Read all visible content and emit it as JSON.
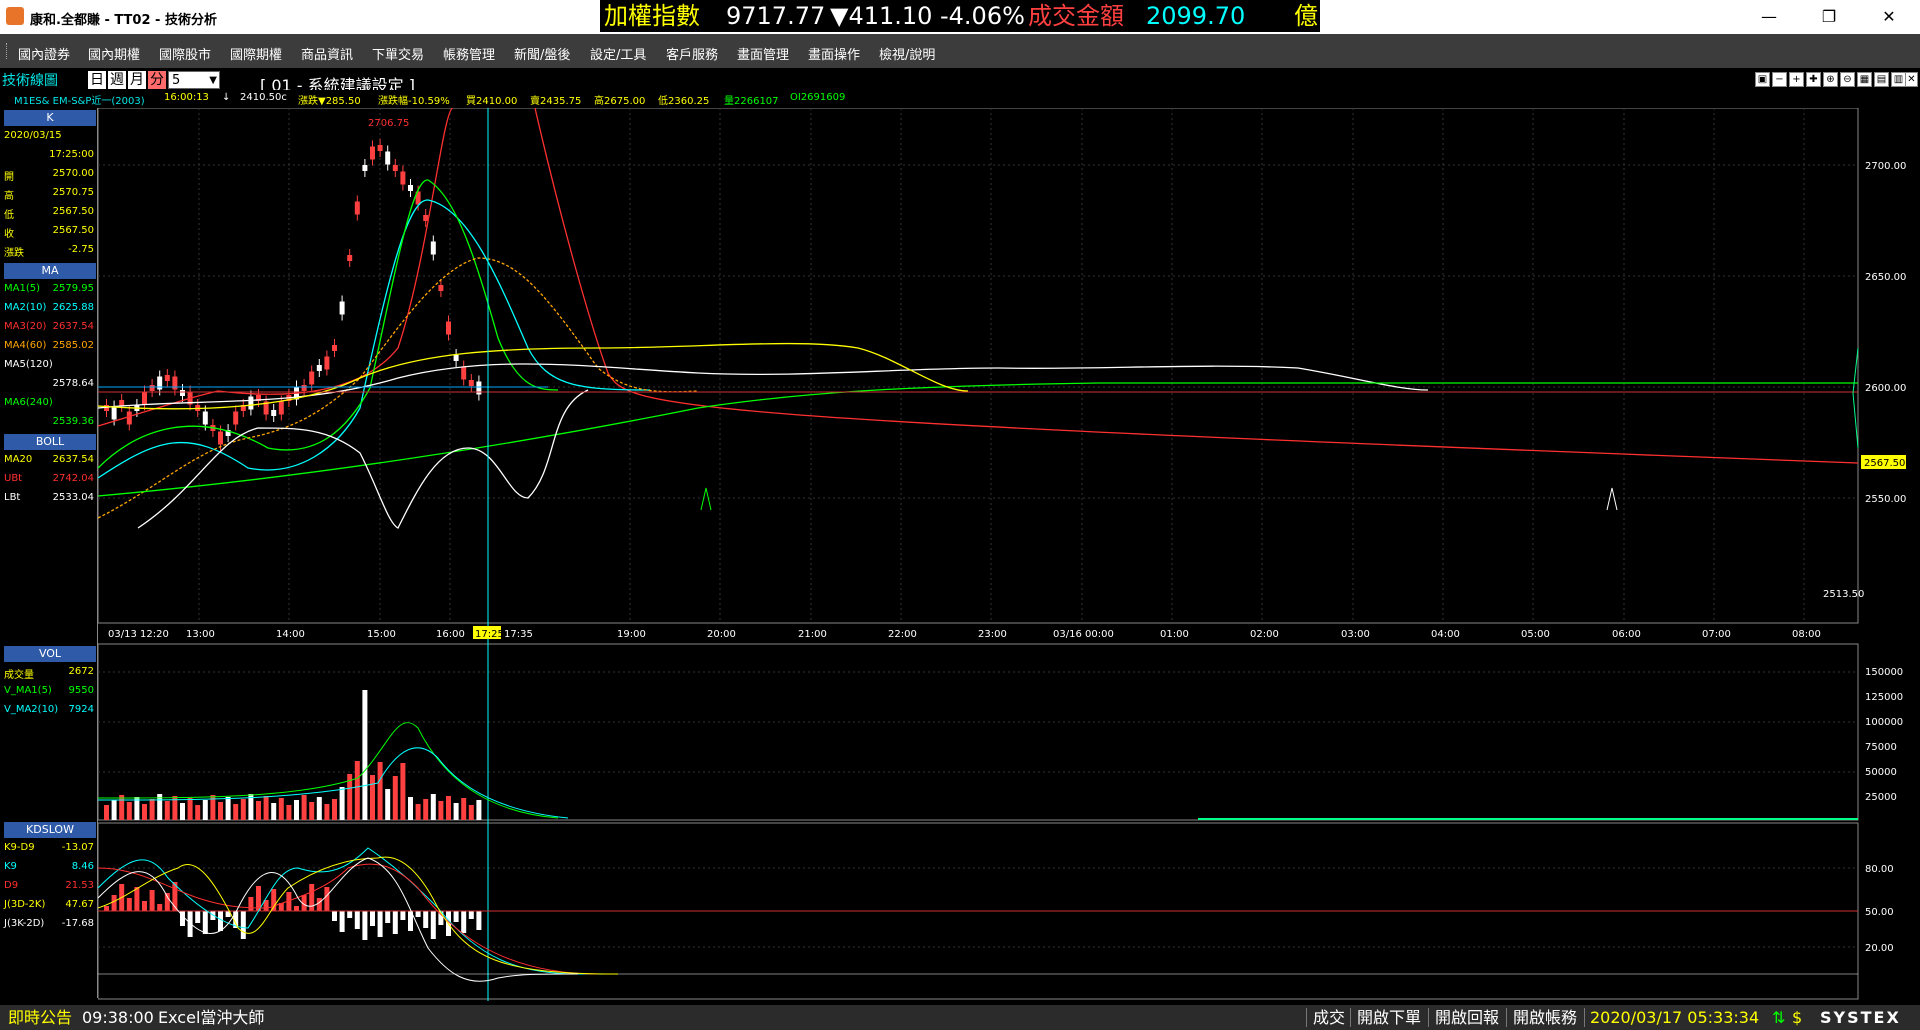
{
  "app": {
    "title": "康和.全都賺 - TT02 - 技術分析"
  },
  "ticker": {
    "label": "加權指數",
    "value": "9717.77",
    "change": "▼411.10",
    "pct": "-4.06%",
    "vol_label": "成交金額",
    "vol_value": "2099.70",
    "unit": "億",
    "colors": {
      "label": "#ffff00",
      "value": "#ffffff",
      "down": "#ffffff",
      "vol_label": "#ff4040",
      "vol_value": "#00ffff",
      "unit": "#ffff00"
    }
  },
  "window_controls": {
    "minimize": "—",
    "maximize": "❐",
    "close": "✕"
  },
  "menu": [
    "國內證券",
    "國內期權",
    "國際股市",
    "國際期權",
    "商品資訊",
    "下單交易",
    "帳務管理",
    "新聞/盤後",
    "設定/工具",
    "客戶服務",
    "畫面管理",
    "畫面操作",
    "檢視/說明"
  ],
  "toolbar": {
    "title": "技術線圖",
    "periods": [
      "日",
      "週",
      "月",
      "分"
    ],
    "active_period": "分",
    "interval": "5",
    "config": "[ 01 - 系統建議設定 ]",
    "icons": [
      "restore-icon",
      "minus-icon",
      "plus-icon",
      "cross-icon",
      "zoom-in-icon",
      "zoom-out-icon",
      "image-icon",
      "save-icon",
      "print-icon",
      "settings-icon"
    ]
  },
  "quote": {
    "symbol": "M1ES& EM-S&P近一(2003)",
    "time": "16:00:13",
    "arrow": "↓",
    "last": "2410.50c",
    "chg": "漲跌▼285.50",
    "chgpct": "漲跌幅-10.59%",
    "bid": "買2410.00",
    "ask": "賣2435.75",
    "high": "高2675.00",
    "low": "低2360.25",
    "vol": "量2266107",
    "oi": "OI2691609"
  },
  "left": {
    "k": {
      "head": "K",
      "date": "2020/03/15",
      "time": "17:25:00",
      "rows": [
        {
          "label": "開",
          "value": "2570.00"
        },
        {
          "label": "高",
          "value": "2570.75"
        },
        {
          "label": "低",
          "value": "2567.50"
        },
        {
          "label": "收",
          "value": "2567.50"
        },
        {
          "label": "漲跌",
          "value": "-2.75"
        }
      ]
    },
    "ma": {
      "head": "MA",
      "rows": [
        {
          "label": "MA1(5)",
          "value": "2579.95",
          "color": "#00ff00"
        },
        {
          "label": "MA2(10)",
          "value": "2625.88",
          "color": "#00ffff"
        },
        {
          "label": "MA3(20)",
          "value": "2637.54",
          "color": "#ff3030"
        },
        {
          "label": "MA4(60)",
          "value": "2585.02",
          "color": "#ffa500"
        },
        {
          "label": "MA5(120)",
          "value": "2578.64",
          "color": "#ffffff"
        },
        {
          "label": "MA6(240)",
          "value": "2539.36",
          "color": "#00ff00"
        }
      ]
    },
    "boll": {
      "head": "BOLL",
      "rows": [
        {
          "label": "MA20",
          "value": "2637.54",
          "color": "#ffff00"
        },
        {
          "label": "UBt",
          "value": "2742.04",
          "color": "#ff3030"
        },
        {
          "label": "LBt",
          "value": "2533.04",
          "color": "#ffffff"
        }
      ]
    },
    "vol": {
      "head": "VOL",
      "rows": [
        {
          "label": "成交量",
          "value": "2672",
          "color": "#ffff00"
        },
        {
          "label": "V_MA1(5)",
          "value": "9550",
          "color": "#00ff00"
        },
        {
          "label": "V_MA2(10)",
          "value": "7924",
          "color": "#00ffff"
        }
      ]
    },
    "kd": {
      "head": "KDSLOW",
      "rows": [
        {
          "label": "K9-D9",
          "value": "-13.07",
          "color": "#ffff00"
        },
        {
          "label": "K9",
          "value": "8.46",
          "color": "#00ffff"
        },
        {
          "label": "D9",
          "value": "21.53",
          "color": "#ff3030"
        },
        {
          "label": "J(3D-2K)",
          "value": "47.67",
          "color": "#ffff00"
        },
        {
          "label": "J(3K-2D)",
          "value": "-17.68",
          "color": "#ffffff"
        }
      ]
    }
  },
  "chart": {
    "price_ticks": [
      "2700.00",
      "2650.00",
      "2600.00",
      "2550.00"
    ],
    "last_price": "2567.50",
    "high_label": "2706.75",
    "low_label": "2513.50",
    "time_ticks": [
      "03/13 12:20",
      "13:00",
      "14:00",
      "15:00",
      "16:00",
      "17:25",
      "17:35",
      "19:00",
      "20:00",
      "21:00",
      "22:00",
      "23:00",
      "03/16 00:00",
      "01:00",
      "02:00",
      "03:00",
      "04:00",
      "05:00",
      "06:00",
      "07:00",
      "08:00"
    ],
    "vol_ticks": [
      "150000",
      "125000",
      "100000",
      "75000",
      "50000",
      "25000"
    ],
    "kd_ticks": [
      "80.00",
      "50.00",
      "20.00"
    ]
  },
  "status": {
    "announce": "即時公告",
    "time": "09:38:00",
    "msg": "Excel當沖大師",
    "items": [
      "成交",
      "開啟下單",
      "開啟回報",
      "開啟帳務"
    ],
    "datetime": "2020/03/17 05:33:34",
    "brand": "SYSTEX"
  }
}
